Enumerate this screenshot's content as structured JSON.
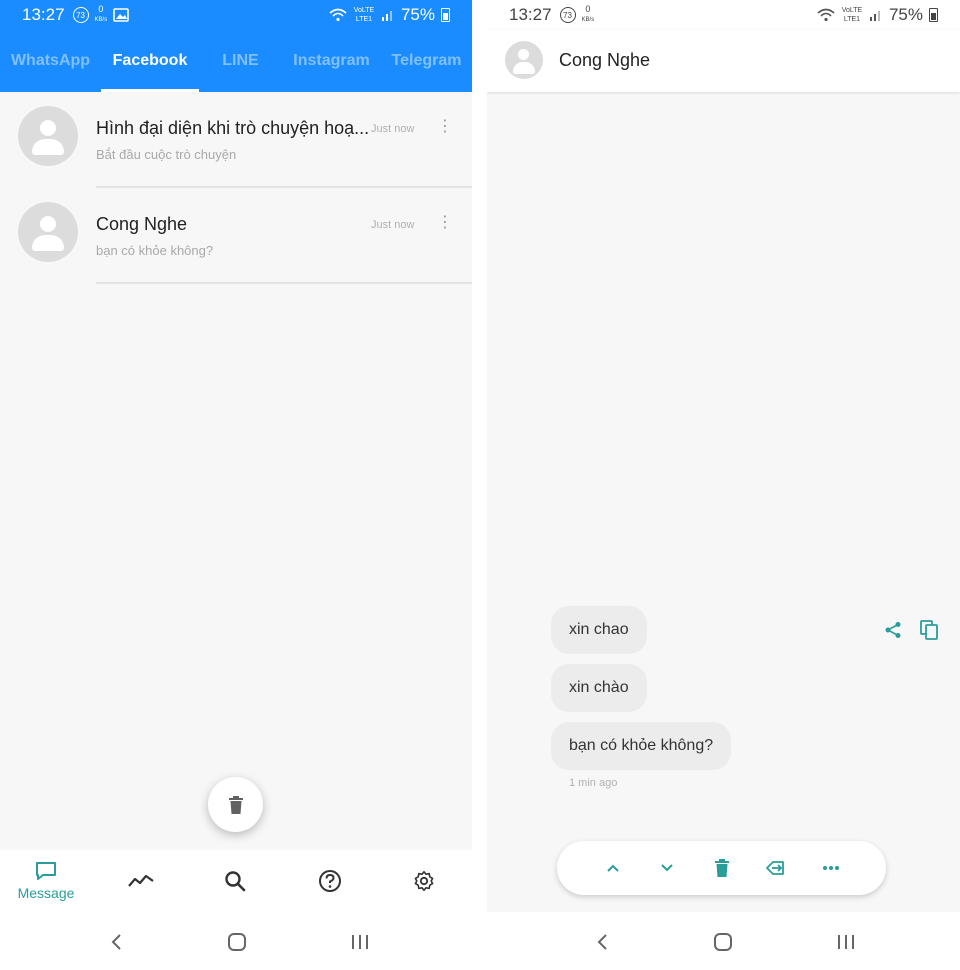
{
  "left": {
    "status": {
      "time": "13:27",
      "speed_value": "0",
      "speed_unit": "KB/s",
      "notif_count": "73",
      "network": "VoLTE LTE1",
      "battery": "75%"
    },
    "tabs": [
      {
        "label": "WhatsApp",
        "active": false
      },
      {
        "label": "Facebook",
        "active": true
      },
      {
        "label": "LINE",
        "active": false
      },
      {
        "label": "Instagram",
        "active": false
      },
      {
        "label": "Telegram",
        "active": false
      }
    ],
    "conversations": [
      {
        "name": "Hình đại diện khi trò chuyện hoạ...",
        "preview": "Bắt đầu cuộc trò chuyện",
        "time": "Just now"
      },
      {
        "name": "Cong Nghe",
        "preview": "bạn có khỏe không?",
        "time": "Just now"
      }
    ],
    "fab_icon": "trash-icon",
    "bottom_nav": [
      {
        "icon": "message-icon",
        "label": "Message",
        "active": true
      },
      {
        "icon": "trend-icon",
        "label": ""
      },
      {
        "icon": "search-icon",
        "label": ""
      },
      {
        "icon": "help-icon",
        "label": ""
      },
      {
        "icon": "gear-icon",
        "label": ""
      }
    ]
  },
  "right": {
    "status": {
      "time": "13:27",
      "speed_value": "0",
      "speed_unit": "KB/s",
      "notif_count": "73",
      "network": "VoLTE LTE1",
      "battery": "75%"
    },
    "chat_title": "Cong Nghe",
    "messages": [
      {
        "text": "xin chao"
      },
      {
        "text": "xin chào"
      },
      {
        "text": "bạn có khỏe không?"
      }
    ],
    "message_time": "1 min ago",
    "message_actions": [
      "share-icon",
      "copy-icon"
    ],
    "toolbar": [
      "chevron-up-icon",
      "chevron-down-icon",
      "trash-icon",
      "export-icon",
      "more-horizontal-icon"
    ]
  },
  "colors": {
    "accent_blue": "#1a8cff",
    "teal": "#2a9d9a"
  }
}
